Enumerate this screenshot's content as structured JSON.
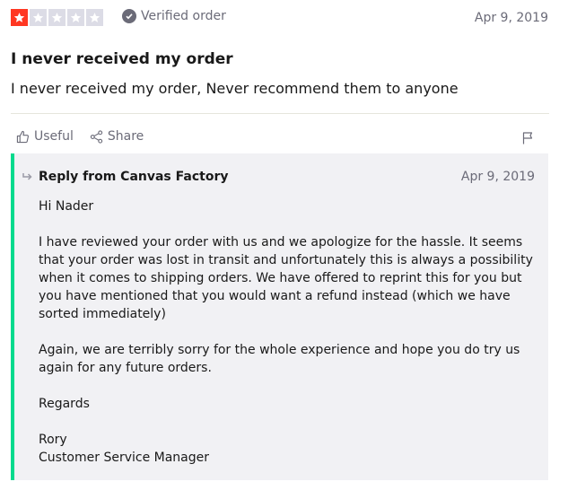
{
  "review": {
    "rating": 1,
    "max_rating": 5,
    "verified_label": "Verified order",
    "date": "Apr 9, 2019",
    "title": "I never received my order",
    "body": "I never received my order, Never recommend them to anyone"
  },
  "actions": {
    "useful_label": "Useful",
    "share_label": "Share"
  },
  "reply": {
    "heading": "Reply from Canvas Factory",
    "date": "Apr 9, 2019",
    "greeting": "Hi Nader",
    "paragraph1": "I have reviewed your order with us and we apologize for the hassle. It seems that your order was lost in transit and unfortunately this is always a possibility when it comes to shipping orders. We have offered to reprint this for you but you have mentioned that you would want a refund instead (which we have sorted immediately)",
    "paragraph2": "Again, we are terribly sorry for the whole experience and hope you do try us again for any future orders.",
    "closing": "Regards",
    "signature_name": "Rory",
    "signature_title": "Customer Service Manager"
  },
  "colors": {
    "star_active": "#ff3722",
    "star_inactive": "#dcdce6",
    "reply_accent": "#04da8d",
    "reply_background": "#f1f1f4"
  }
}
